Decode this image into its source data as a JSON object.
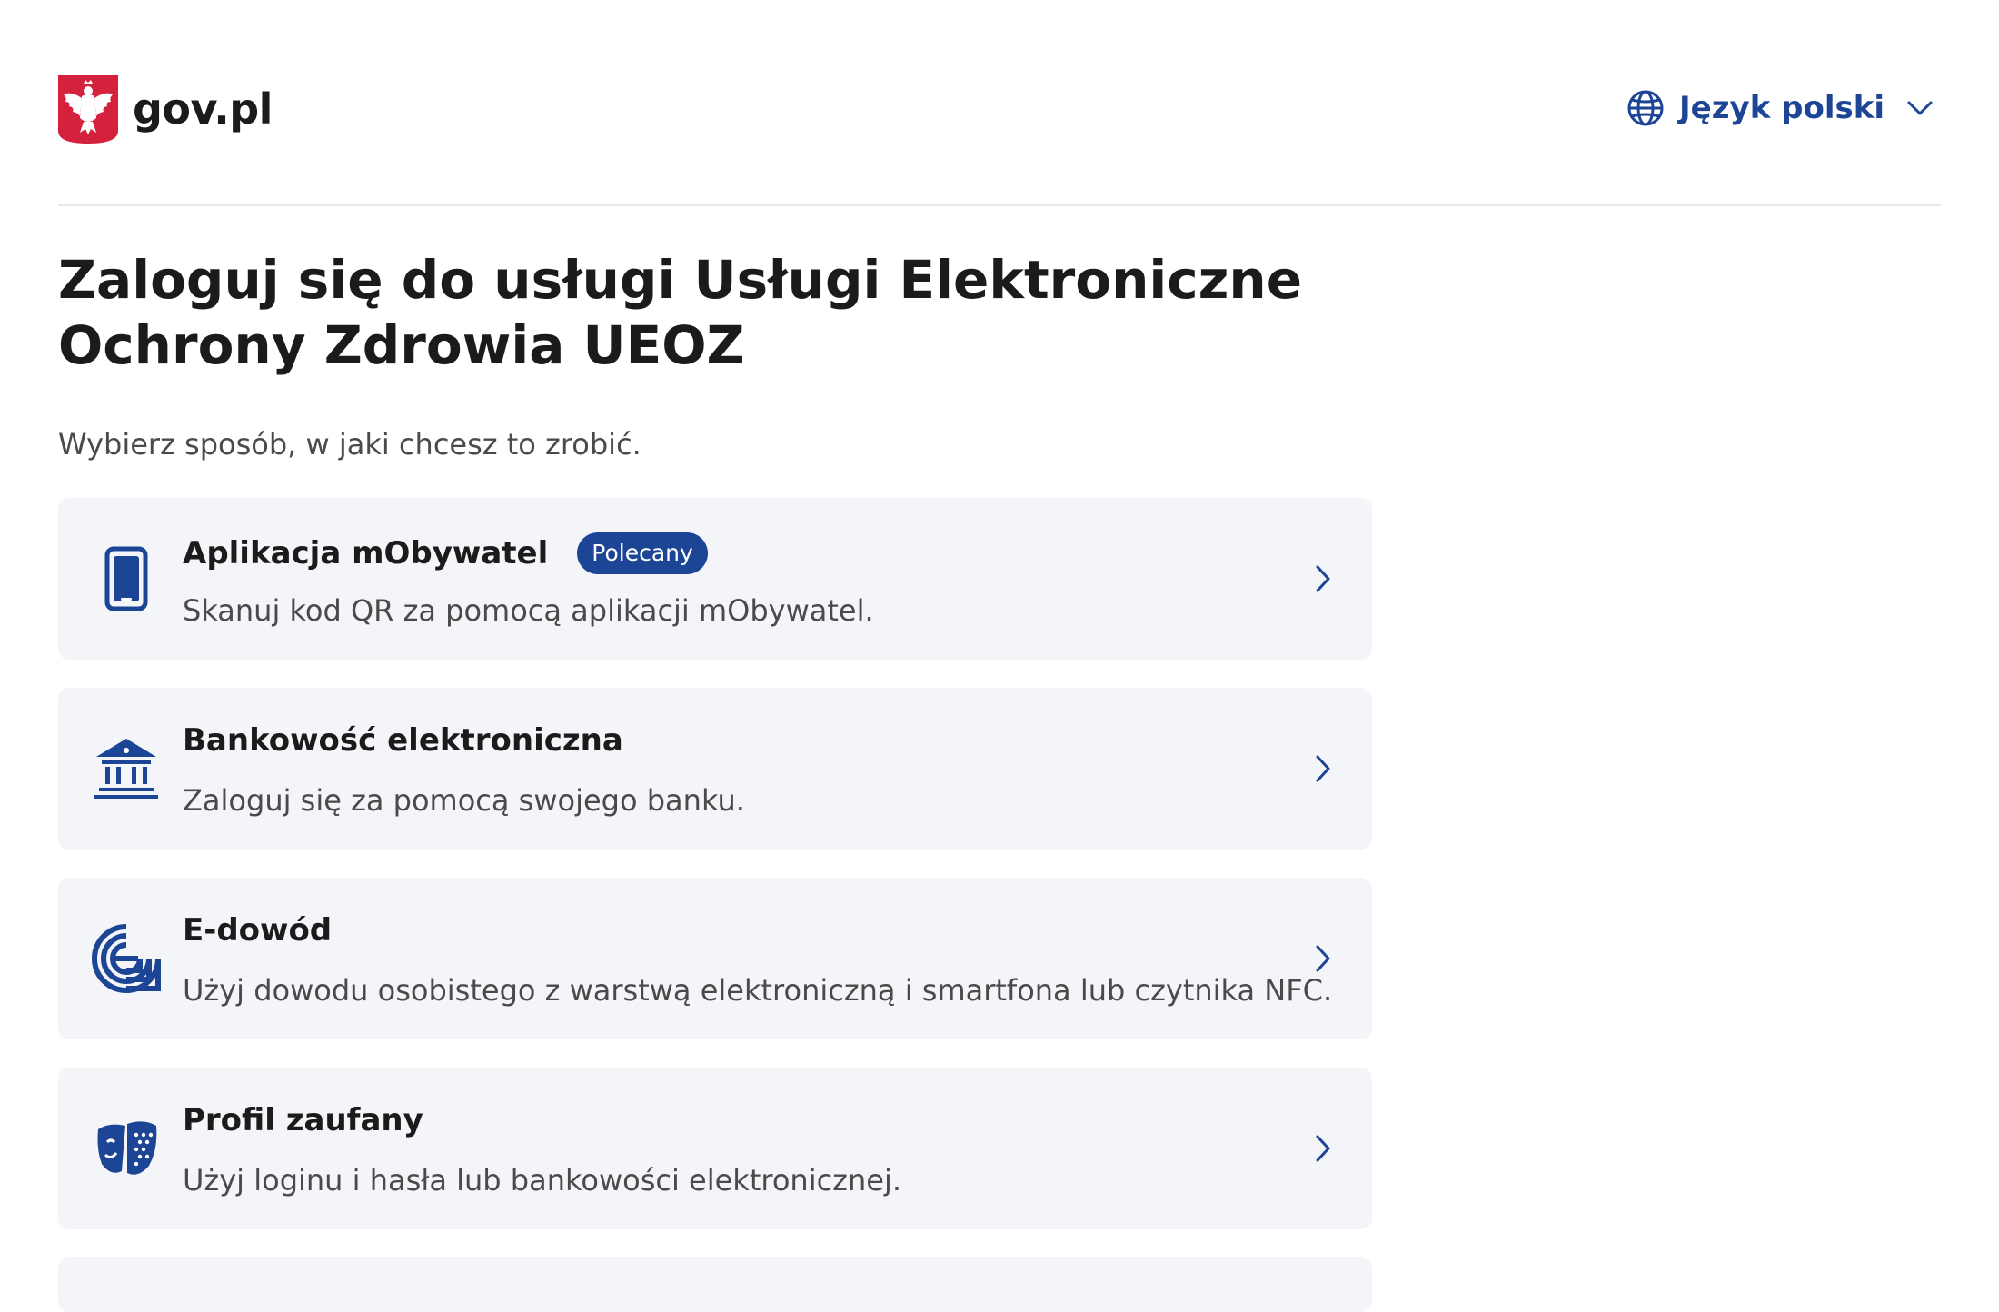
{
  "header": {
    "logo_text": "gov.pl",
    "language_label": "Język polski"
  },
  "main": {
    "title": "Zaloguj się do usługi Usługi Elektroniczne Ochrony Zdrowia UEOZ",
    "subtitle": "Wybierz sposób, w jaki chcesz to zrobić."
  },
  "options": [
    {
      "title": "Aplikacja mObywatel",
      "badge": "Polecany",
      "description": "Skanuj kod QR za pomocą aplikacji mObywatel.",
      "icon": "phone-icon"
    },
    {
      "title": "Bankowość elektroniczna",
      "description": "Zaloguj się za pomocą swojego banku.",
      "icon": "bank-icon"
    },
    {
      "title": "E-dowód",
      "description": "Użyj dowodu osobistego z warstwą elektroniczną i smartfona lub czytnika NFC.",
      "icon": "e-id-icon"
    },
    {
      "title": "Profil zaufany",
      "description": "Użyj loginu i hasła lub bankowości elektronicznej.",
      "icon": "trusted-profile-icon"
    }
  ],
  "colors": {
    "accent": "#1c4596",
    "card_background": "#f4f5f9",
    "emblem_red": "#d4213d",
    "text": "#1b1b1b",
    "muted_text": "#4a4a4a"
  }
}
